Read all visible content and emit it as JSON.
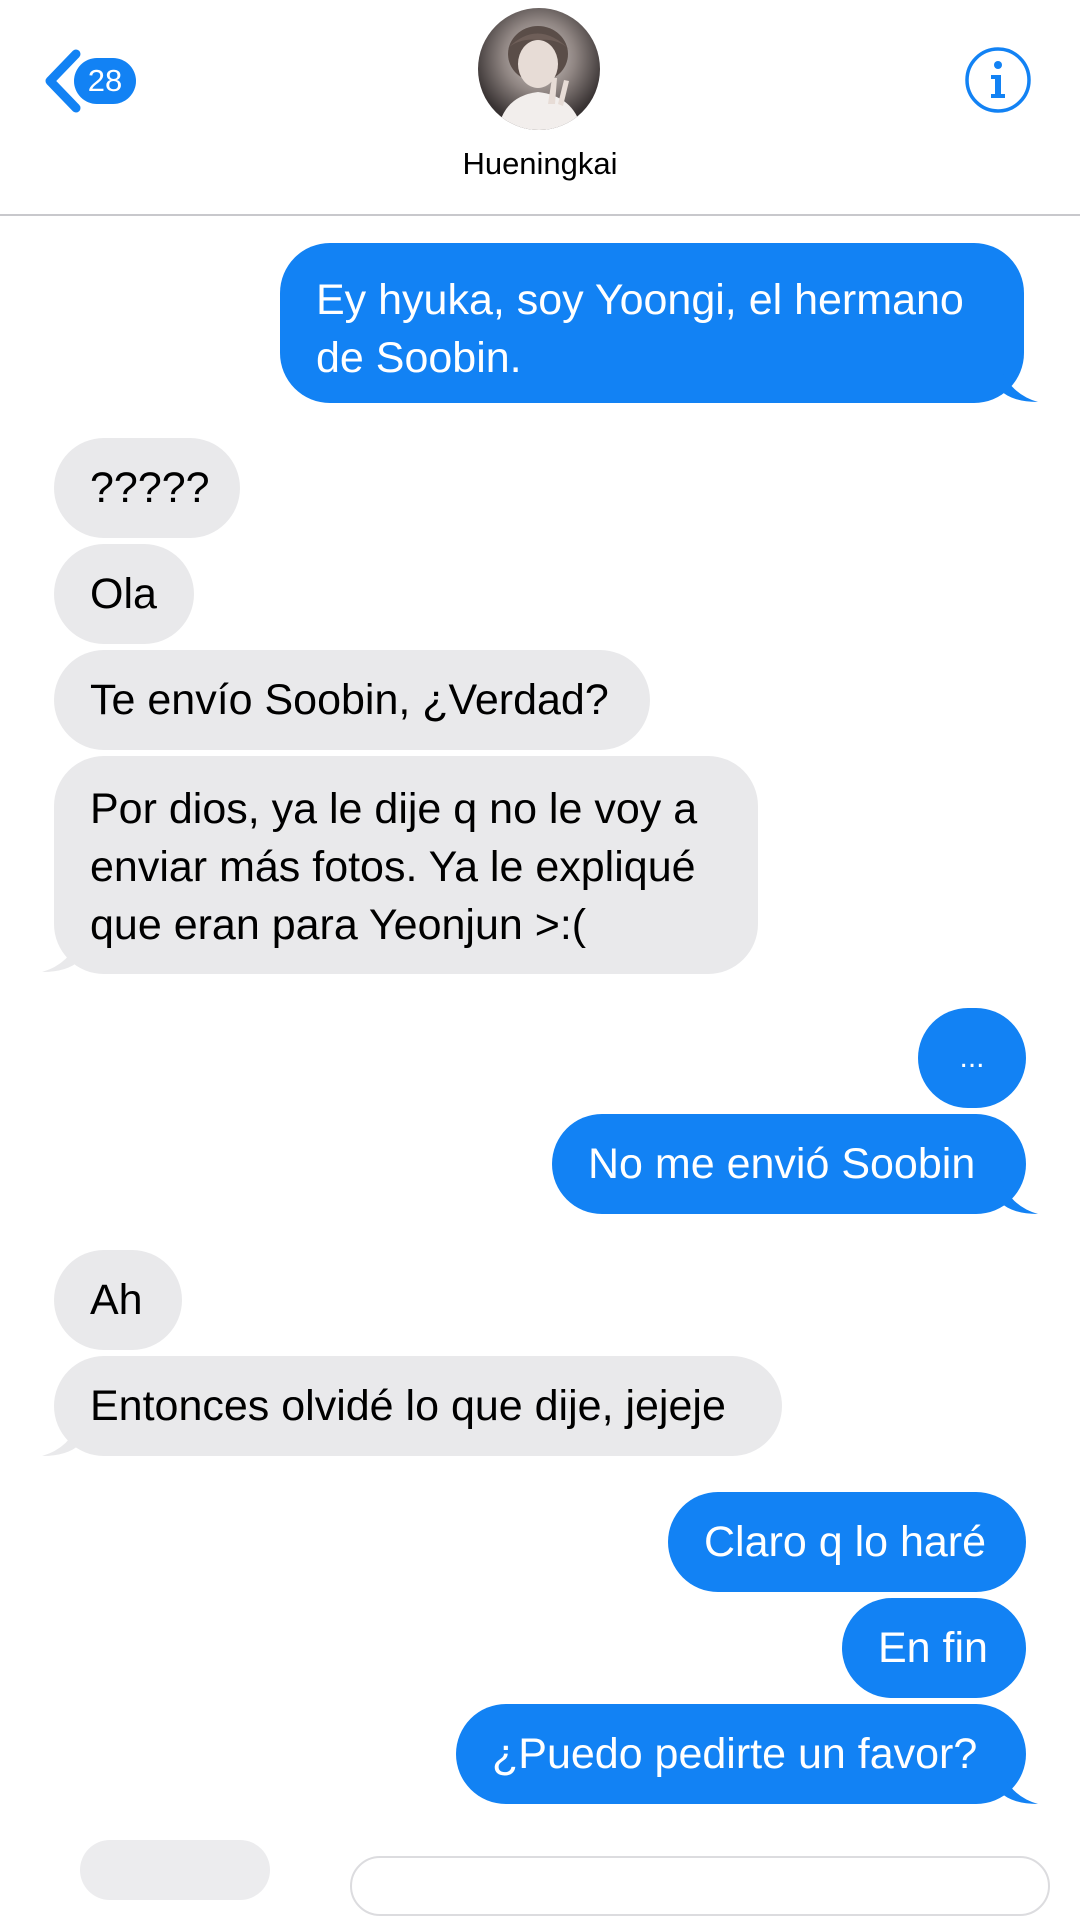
{
  "header": {
    "back_badge": "28",
    "contact_name": "Hueningkai",
    "accent_color": "#1282f4"
  },
  "icons": {
    "back": "chevron-left-icon",
    "info": "info-icon"
  },
  "colors": {
    "sent_bubble": "#1282f4",
    "received_bubble": "#e9e9eb"
  },
  "messages": [
    {
      "from": "me",
      "text": "Ey hyuka, soy Yoongi, el hermano de Soobin."
    },
    {
      "from": "contact",
      "text": "?????"
    },
    {
      "from": "contact",
      "text": "Ola"
    },
    {
      "from": "contact",
      "text": "Te envío Soobin, ¿Verdad?"
    },
    {
      "from": "contact",
      "text": "Por dios, ya le dije q no le voy a enviar más fotos. Ya le expliqué que eran para Yeonjun >:("
    },
    {
      "from": "me",
      "text": "..."
    },
    {
      "from": "me",
      "text": "No me envió Soobin"
    },
    {
      "from": "contact",
      "text": "Ah"
    },
    {
      "from": "contact",
      "text": "Entonces olvidé lo que dije, jejeje"
    },
    {
      "from": "me",
      "text": "Claro q lo haré"
    },
    {
      "from": "me",
      "text": "En fin"
    },
    {
      "from": "me",
      "text": "¿Puedo pedirte un favor?"
    }
  ]
}
